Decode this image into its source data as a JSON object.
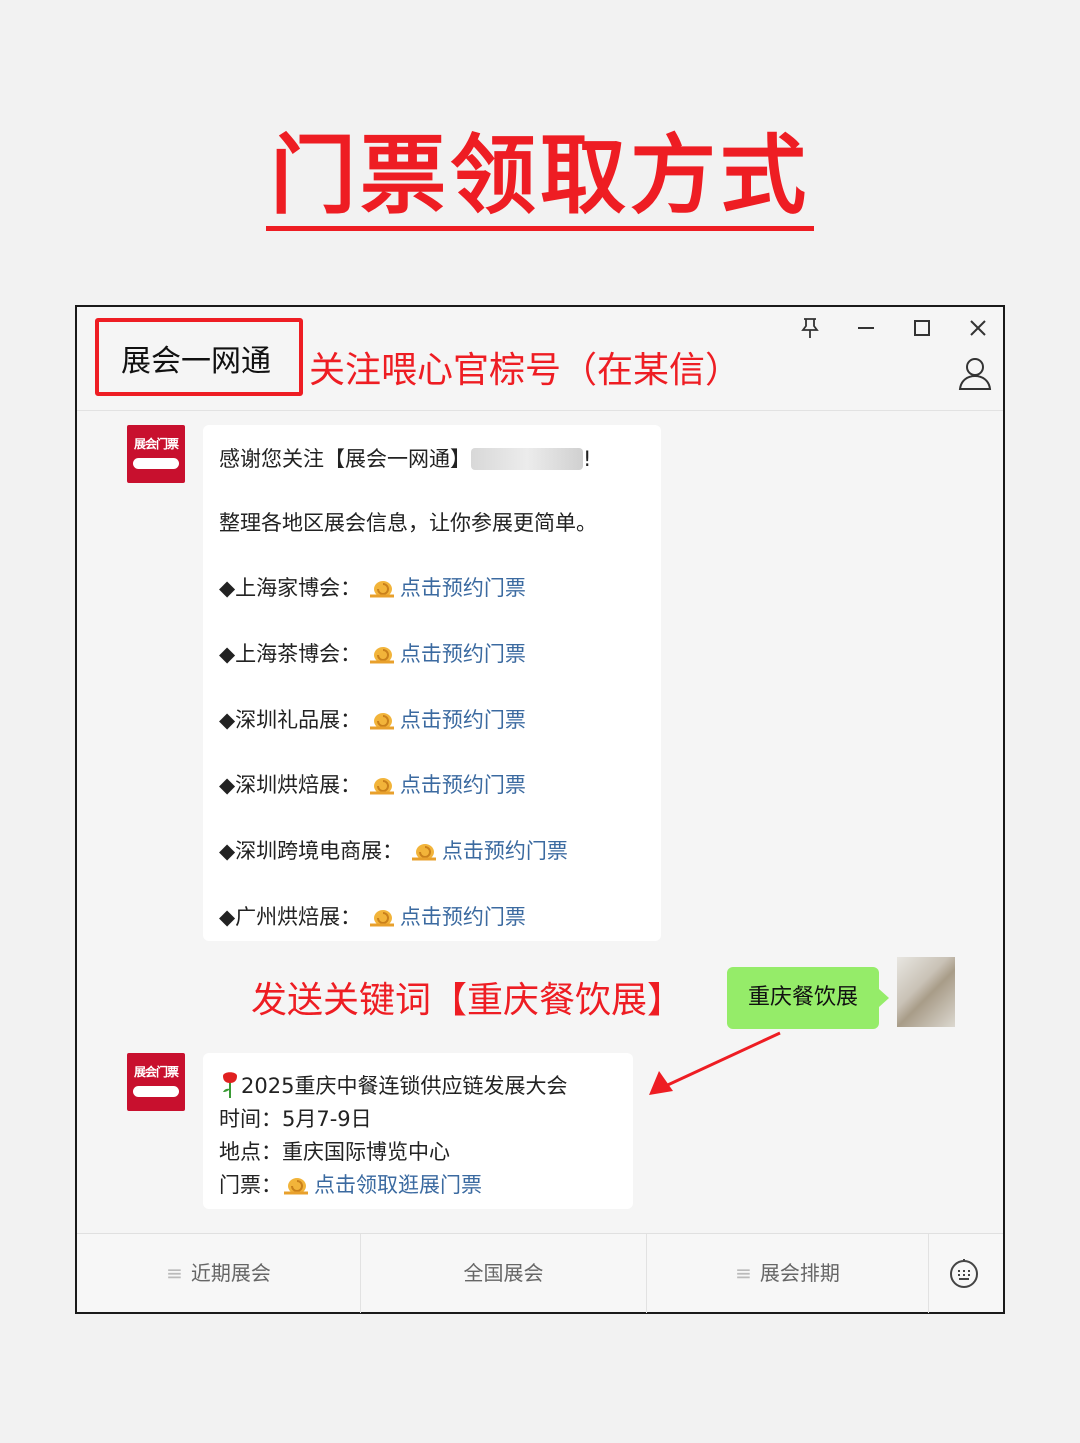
{
  "headline": "门票领取方式",
  "window": {
    "account_name": "展会一网通",
    "follow_note": "关注喂心官棕号（在某信）",
    "controls": {
      "pin": "pin-icon",
      "minimize": "minimize-icon",
      "maximize": "maximize-icon",
      "close": "close-icon"
    }
  },
  "avatar_text": "展会门票",
  "welcome": {
    "greeting_prefix": "感谢您关注【展会一网通】",
    "greeting_suffix": "!",
    "intro": "整理各地区展会信息，让你参展更简单。",
    "items": [
      {
        "label": "◆上海家博会：",
        "link": "点击预约门票"
      },
      {
        "label": "◆上海茶博会：",
        "link": "点击预约门票"
      },
      {
        "label": "◆深圳礼品展：",
        "link": "点击预约门票"
      },
      {
        "label": "◆深圳烘焙展：",
        "link": "点击预约门票"
      },
      {
        "label": "◆深圳跨境电商展：",
        "link": "点击预约门票"
      },
      {
        "label": "◆广州烘焙展：",
        "link": "点击预约门票"
      }
    ]
  },
  "keyword_note": "发送关键词【重庆餐饮展】",
  "sent_message": "重庆餐饮展",
  "reply": {
    "title": "2025重庆中餐连锁供应链发展大会",
    "time": "时间：5月7-9日",
    "place": "地点：重庆国际博览中心",
    "ticket_label": "门票：",
    "ticket_link": "点击领取逛展门票"
  },
  "bottom_menu": [
    "近期展会",
    "全国展会",
    "展会排期"
  ],
  "colors": {
    "accent_red": "#ee1d23",
    "link_blue": "#3b6aa0",
    "bubble_green": "#95ec69"
  }
}
